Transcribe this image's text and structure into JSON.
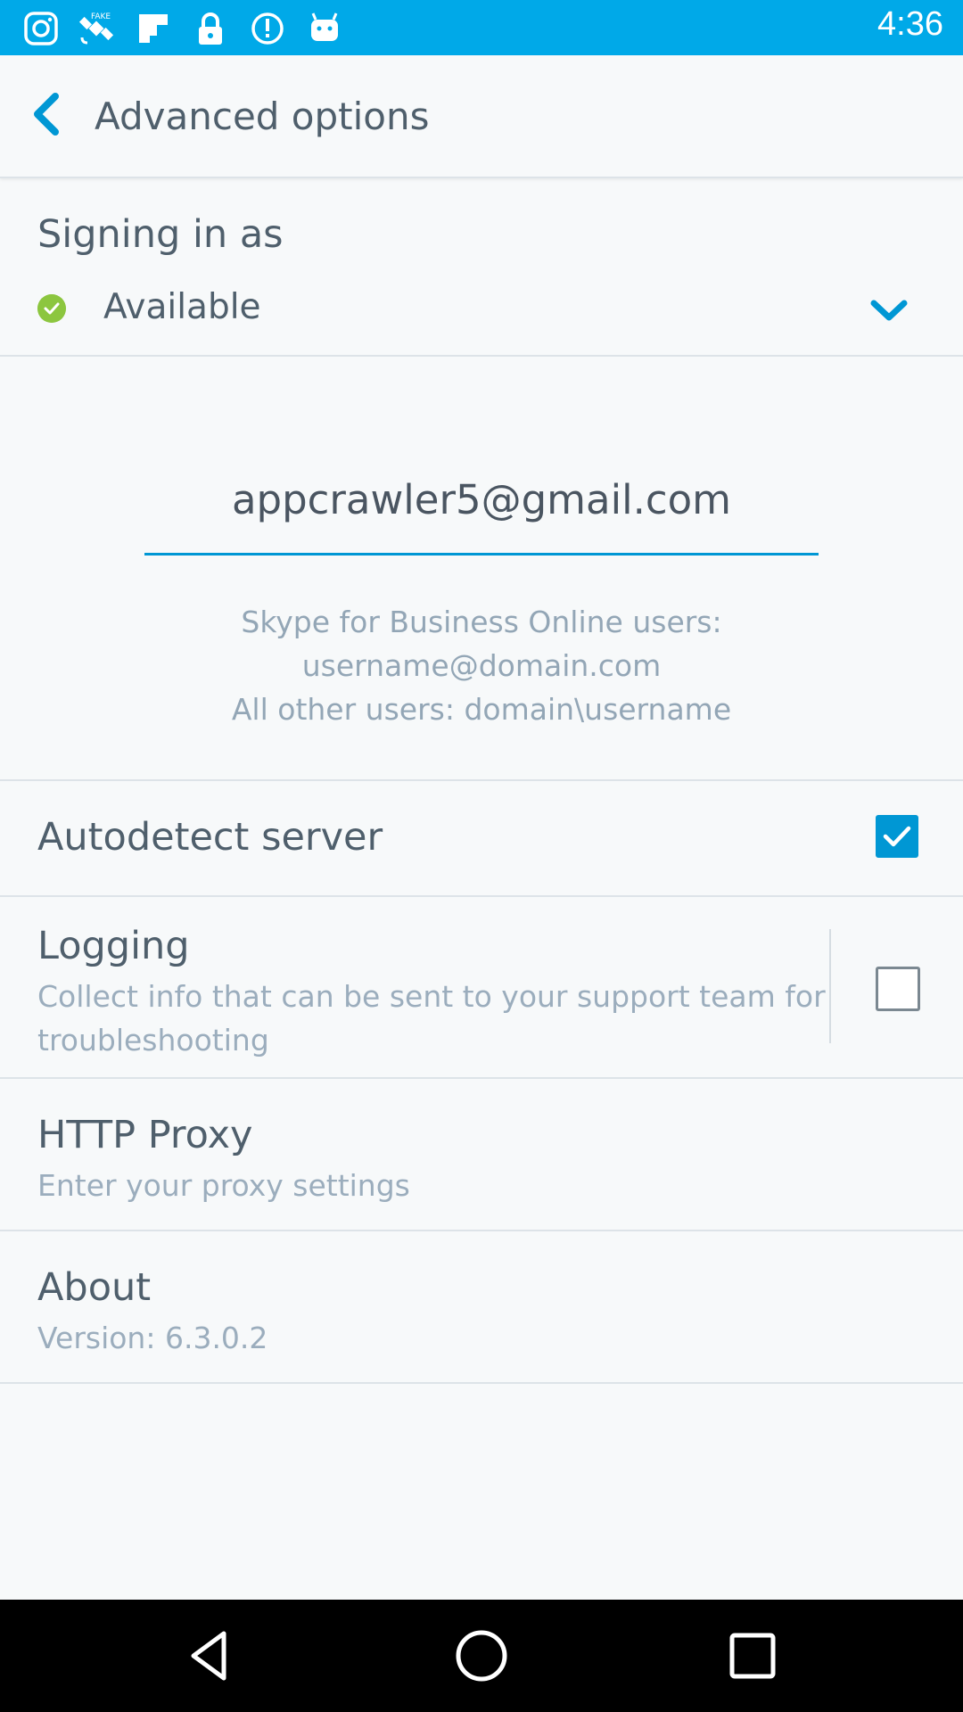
{
  "status_bar": {
    "time": "4:36",
    "icons": [
      "instagram-icon",
      "fake-gps-satellite-icon",
      "flipboard-icon",
      "lock-icon",
      "info-icon",
      "android-robot-icon"
    ]
  },
  "app_bar": {
    "title": "Advanced options",
    "back_icon": "chevron-left-icon"
  },
  "signing": {
    "label": "Signing in as",
    "status": "Available",
    "status_color": "#8cc63f",
    "dropdown_icon": "chevron-down-icon"
  },
  "email": {
    "value": "appcrawler5@gmail.com"
  },
  "hints": {
    "line1": "Skype for Business Online users:",
    "line2": "username@domain.com",
    "line3": "All other users: domain\\username"
  },
  "settings": {
    "autodetect": {
      "title": "Autodetect server",
      "checked": true
    },
    "logging": {
      "title": "Logging",
      "subtitle_line1": "Collect info that can be sent to your support team for",
      "subtitle_line2": "troubleshooting",
      "checked": false
    },
    "proxy": {
      "title": "HTTP Proxy",
      "subtitle": "Enter your proxy settings"
    },
    "about": {
      "title": "About",
      "subtitle": "Version: 6.3.0.2"
    }
  },
  "colors": {
    "accent": "#0097d4",
    "status_bar": "#00a9e8",
    "background": "#f7f9fa"
  },
  "nav_bar": {
    "buttons": [
      "back-triangle-icon",
      "home-circle-icon",
      "recents-square-icon"
    ]
  }
}
